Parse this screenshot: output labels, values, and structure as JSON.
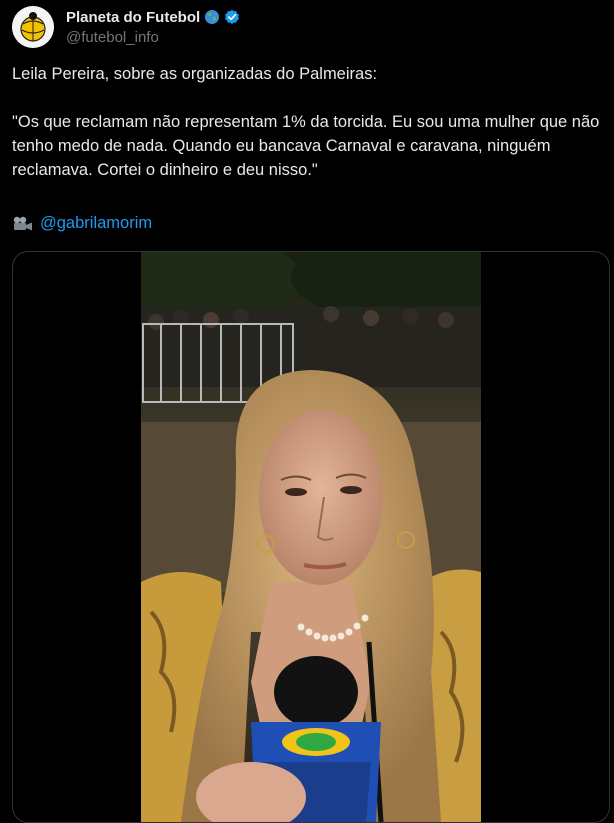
{
  "account": {
    "display_name": "Planeta do Futebol",
    "handle": "@futebol_info",
    "flag_icon": "globe-emoji",
    "verified_icon": "verified-badge-icon",
    "verified_color": "#1d9bf0"
  },
  "tweet": {
    "text": "Leila Pereira, sobre as organizadas do Palmeiras:\n\n\"Os que reclamam não representam 1% da torcida. Eu sou uma mulher que não tenho medo de nada. Quando eu bancava Carnaval e caravana, ninguém reclamava. Cortei o dinheiro e deu nisso.\"",
    "credit_icon": "movie-camera-icon",
    "credit_handle": "@gabrilamorim",
    "link_color": "#1d9bf0"
  },
  "media": {
    "type": "video",
    "subject": "woman speaking into microphone at night"
  }
}
